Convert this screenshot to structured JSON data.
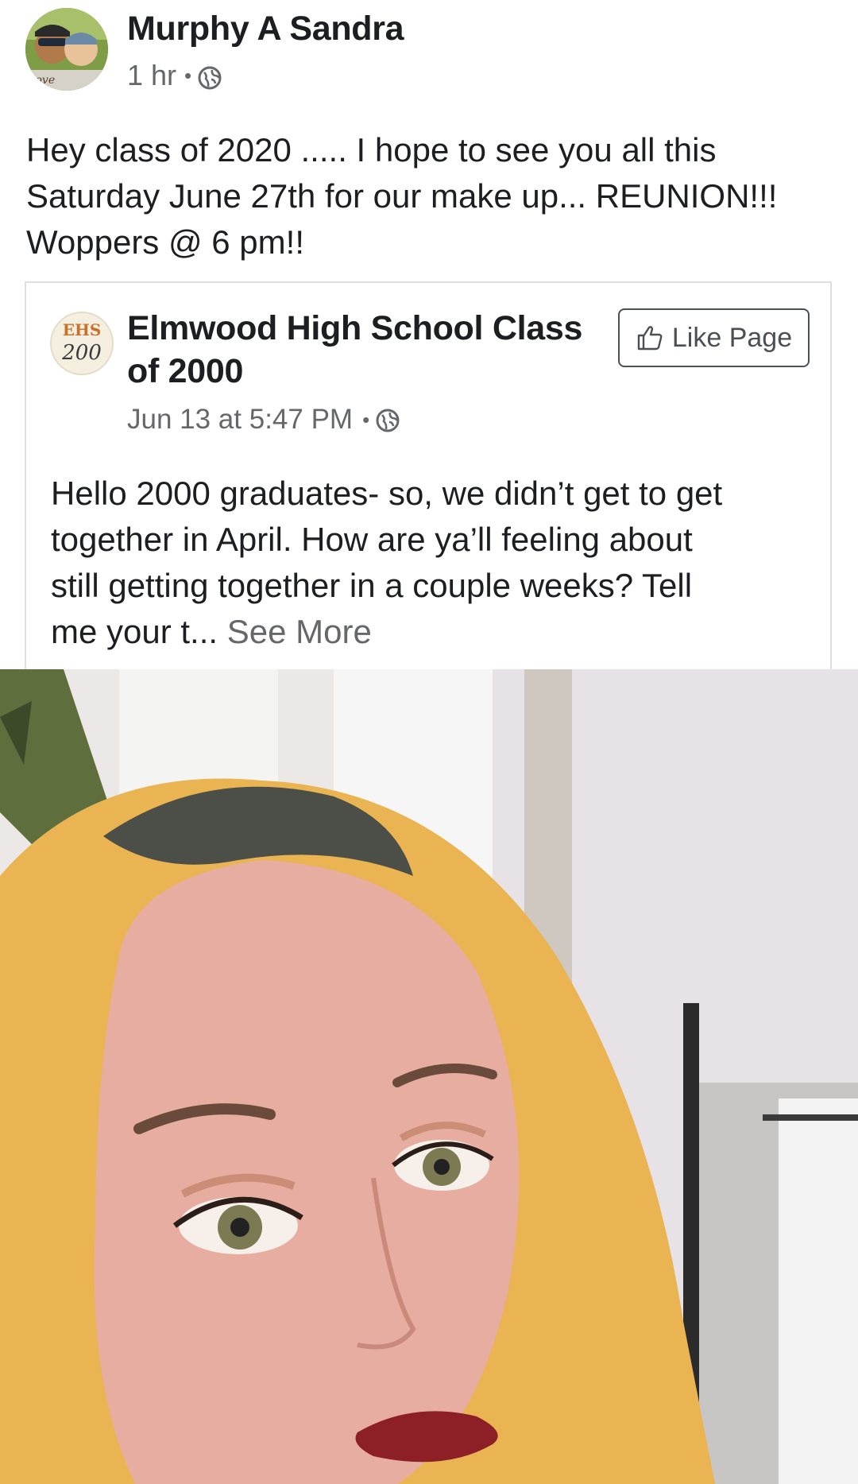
{
  "post": {
    "author": "Murphy A Sandra",
    "time": "1 hr",
    "separator": "•",
    "privacy_icon": "globe-icon",
    "text_lines": [
      "Hey class of 2020 ..... I hope to see you all this",
      "Saturday June 27th for our make up... REUNION!!!",
      "Woppers @ 6 pm!!"
    ]
  },
  "shared": {
    "page_name_lines": [
      "Elmwood High School Class",
      "of 2000"
    ],
    "like_button_label": "Like Page",
    "like_icon": "thumbs-up-icon",
    "timestamp": "Jun 13 at 5:47 PM",
    "separator": "•",
    "privacy_icon": "globe-icon",
    "text_lines": [
      "Hello 2000 graduates- so, we didn’t get to get",
      "together in April. How are ya’ll feeling about",
      "still getting together in a couple weeks? Tell"
    ],
    "last_line_text": "me your t...",
    "see_more_label": "See More"
  },
  "photo": {
    "subject": "selfie"
  },
  "colors": {
    "text": "#1c1e21",
    "secondary": "#65676b",
    "border": "#dddfe2"
  }
}
